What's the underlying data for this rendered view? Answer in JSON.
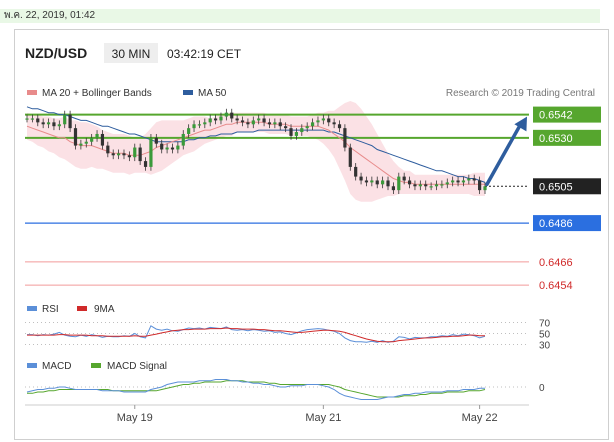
{
  "header": {
    "date": "พ.ค. 22, 2019, 01:42",
    "symbol": "NZD/USD",
    "interval": "30 MIN",
    "time": "03:42:19 CET"
  },
  "colors": {
    "ma20": "#e88b8b",
    "ma50": "#2e5d9e",
    "band_fill": "#f7c8cf",
    "resistance": "#56a62e",
    "support": "#2b6fe0",
    "extra_support": "#f29a9a",
    "current": "#222222",
    "rsi": "#5b8fd8",
    "rsi_ma": "#d02a2a",
    "macd": "#5b8fd8",
    "macd_signal": "#56a62e",
    "arrow": "#2e5d9e"
  },
  "chart_data": {
    "type": "candlestick",
    "title": "NZD/USD",
    "legend": [
      "MA 20 + Bollinger Bands",
      "MA 50"
    ],
    "watermark": "Research © 2019 Trading Central",
    "x_ticks": [
      {
        "label": "May 19",
        "index": 20
      },
      {
        "label": "May 21",
        "index": 55
      },
      {
        "label": "May 22",
        "index": 84
      }
    ],
    "ylim": [
      0.64525,
      0.65485
    ],
    "levels": [
      {
        "value": 0.6542,
        "label": "0.6542",
        "kind": "resistance"
      },
      {
        "value": 0.653,
        "label": "0.6530",
        "kind": "resistance"
      },
      {
        "value": 0.6505,
        "label": "0.6505",
        "kind": "current"
      },
      {
        "value": 0.6486,
        "label": "0.6486",
        "kind": "support"
      },
      {
        "value": 0.6466,
        "label": "0.6466",
        "kind": "extra"
      },
      {
        "value": 0.6454,
        "label": "0.6454",
        "kind": "extra"
      }
    ],
    "close": [
      0.654,
      0.654,
      0.6538,
      0.6537,
      0.6538,
      0.6536,
      0.6537,
      0.6542,
      0.6535,
      0.6526,
      0.6527,
      0.6528,
      0.653,
      0.6532,
      0.6526,
      0.6522,
      0.6521,
      0.6522,
      0.6521,
      0.652,
      0.6525,
      0.6518,
      0.6515,
      0.653,
      0.6527,
      0.6524,
      0.6525,
      0.6524,
      0.6526,
      0.6532,
      0.6535,
      0.6537,
      0.6537,
      0.6538,
      0.654,
      0.6539,
      0.6541,
      0.6543,
      0.654,
      0.6539,
      0.6538,
      0.6537,
      0.6539,
      0.654,
      0.6538,
      0.6537,
      0.6538,
      0.6536,
      0.6535,
      0.6531,
      0.6533,
      0.6535,
      0.6536,
      0.6538,
      0.6539,
      0.654,
      0.6538,
      0.6537,
      0.6535,
      0.6525,
      0.6515,
      0.651,
      0.6508,
      0.6507,
      0.6508,
      0.6506,
      0.6508,
      0.6505,
      0.6503,
      0.651,
      0.6508,
      0.6506,
      0.6505,
      0.6506,
      0.6505,
      0.6505,
      0.6506,
      0.6506,
      0.6507,
      0.6508,
      0.6507,
      0.6508,
      0.6509,
      0.6508,
      0.6503,
      0.6505
    ],
    "ma20": [
      0.6536,
      0.6535,
      0.6534,
      0.6533,
      0.6532,
      0.6531,
      0.653,
      0.653,
      0.6528,
      0.6527,
      0.6526,
      0.6526,
      0.6526,
      0.6525,
      0.6524,
      0.6523,
      0.6522,
      0.6522,
      0.6522,
      0.6521,
      0.6521,
      0.6521,
      0.6522,
      0.6523,
      0.6525,
      0.6526,
      0.6527,
      0.6528,
      0.6529,
      0.653,
      0.6531,
      0.6532,
      0.6533,
      0.6534,
      0.6534,
      0.6535,
      0.6536,
      0.6537,
      0.6537,
      0.6538,
      0.6538,
      0.6538,
      0.6538,
      0.6538,
      0.6538,
      0.6537,
      0.6537,
      0.6537,
      0.6537,
      0.6536,
      0.6536,
      0.6536,
      0.6536,
      0.6536,
      0.6536,
      0.6535,
      0.6534,
      0.6532,
      0.653,
      0.6528,
      0.6525,
      0.6523,
      0.6521,
      0.6519,
      0.6517,
      0.6515,
      0.6513,
      0.6511,
      0.6509,
      0.6508,
      0.6507,
      0.6507,
      0.6506,
      0.6506,
      0.6506,
      0.6506,
      0.6506,
      0.6506,
      0.6506,
      0.6506,
      0.6506,
      0.6506,
      0.6506,
      0.6506,
      0.6506,
      0.6506
    ],
    "ma50": [
      0.6546,
      0.6545,
      0.6545,
      0.6544,
      0.6543,
      0.6543,
      0.6542,
      0.6542,
      0.6541,
      0.654,
      0.6539,
      0.6539,
      0.6538,
      0.6537,
      0.6536,
      0.6536,
      0.6535,
      0.6534,
      0.6533,
      0.6532,
      0.6532,
      0.6531,
      0.653,
      0.6529,
      0.6528,
      0.6528,
      0.6528,
      0.6528,
      0.6528,
      0.6528,
      0.6529,
      0.6529,
      0.653,
      0.653,
      0.6531,
      0.6531,
      0.6532,
      0.6532,
      0.6532,
      0.6533,
      0.6533,
      0.6533,
      0.6533,
      0.6534,
      0.6534,
      0.6534,
      0.6534,
      0.6534,
      0.6534,
      0.6534,
      0.6534,
      0.6534,
      0.6534,
      0.6534,
      0.6534,
      0.6534,
      0.6533,
      0.6533,
      0.6532,
      0.6531,
      0.653,
      0.6529,
      0.6528,
      0.6527,
      0.6526,
      0.6524,
      0.6523,
      0.6522,
      0.6521,
      0.652,
      0.6519,
      0.6518,
      0.6517,
      0.6516,
      0.6515,
      0.6514,
      0.6513,
      0.6513,
      0.6512,
      0.6511,
      0.651,
      0.651,
      0.6509,
      0.6509,
      0.6508,
      0.6507
    ],
    "band": [
      0.0007,
      0.0007,
      0.0008,
      0.0008,
      0.0009,
      0.0009,
      0.001,
      0.0011,
      0.0011,
      0.0012,
      0.0012,
      0.0012,
      0.0011,
      0.0011,
      0.001,
      0.001,
      0.001,
      0.001,
      0.001,
      0.001,
      0.0009,
      0.0009,
      0.001,
      0.0012,
      0.0013,
      0.0013,
      0.0012,
      0.0011,
      0.001,
      0.0009,
      0.0009,
      0.0009,
      0.0008,
      0.0007,
      0.0006,
      0.0006,
      0.0006,
      0.0006,
      0.0006,
      0.0005,
      0.0005,
      0.0005,
      0.0005,
      0.0005,
      0.0005,
      0.0005,
      0.0005,
      0.0005,
      0.0005,
      0.0005,
      0.0005,
      0.0005,
      0.0005,
      0.0006,
      0.0007,
      0.0008,
      0.001,
      0.0012,
      0.0016,
      0.002,
      0.0024,
      0.0025,
      0.0024,
      0.0022,
      0.002,
      0.0017,
      0.0014,
      0.0011,
      0.0009,
      0.0007,
      0.0006,
      0.0006,
      0.0005,
      0.0005,
      0.0005,
      0.0005,
      0.0005,
      0.0005,
      0.0005,
      0.0005,
      0.0005,
      0.0005,
      0.0005,
      0.0006,
      0.0006,
      0.0006
    ],
    "forecast": {
      "from": 0.6505,
      "to": 0.6542
    },
    "rsi": {
      "legend": [
        "RSI",
        "9MA"
      ],
      "levels": [
        70,
        50,
        30
      ],
      "ylim": [
        20,
        80
      ],
      "values": [
        48,
        48,
        46,
        48,
        47,
        49,
        52,
        47,
        45,
        44,
        47,
        45,
        48,
        46,
        43,
        45,
        44,
        44,
        46,
        45,
        50,
        44,
        42,
        64,
        58,
        56,
        58,
        55,
        54,
        57,
        60,
        59,
        60,
        58,
        61,
        60,
        59,
        62,
        57,
        56,
        57,
        55,
        57,
        56,
        54,
        55,
        52,
        53,
        50,
        48,
        51,
        55,
        57,
        58,
        59,
        58,
        56,
        54,
        50,
        42,
        37,
        35,
        35,
        34,
        36,
        34,
        37,
        34,
        36,
        44,
        43,
        40,
        43,
        42,
        42,
        44,
        44,
        46,
        45,
        48,
        46,
        49,
        48,
        46,
        42,
        45
      ],
      "ma": [
        47,
        47,
        47,
        47,
        47,
        47,
        48,
        48,
        47,
        47,
        47,
        47,
        46,
        46,
        46,
        45,
        45,
        45,
        45,
        45,
        46,
        45,
        45,
        47,
        49,
        51,
        53,
        55,
        56,
        57,
        57,
        58,
        58,
        58,
        59,
        59,
        59,
        60,
        59,
        59,
        58,
        58,
        58,
        57,
        57,
        56,
        55,
        55,
        54,
        53,
        52,
        52,
        53,
        54,
        55,
        56,
        56,
        55,
        54,
        52,
        49,
        46,
        43,
        40,
        38,
        36,
        35,
        35,
        35,
        37,
        38,
        39,
        40,
        41,
        42,
        42,
        43,
        44,
        44,
        45,
        45,
        46,
        47,
        47,
        46,
        46
      ]
    },
    "macd": {
      "legend": [
        "MACD",
        "MACD Signal"
      ],
      "zero_label": "0",
      "ylim": [
        -0.0012,
        0.0012
      ],
      "macd": [
        -0.0004,
        -0.0003,
        -0.0002,
        -0.0002,
        -0.0001,
        -0.0001,
        0.0,
        0.0,
        -0.0001,
        -0.0002,
        -0.0002,
        -0.0002,
        -0.0002,
        -0.0002,
        -0.0003,
        -0.0003,
        -0.0003,
        -0.0003,
        -0.0004,
        -0.0004,
        -0.0004,
        -0.0004,
        -0.0004,
        -0.0002,
        -0.0001,
        0.0,
        0.0002,
        0.0003,
        0.0004,
        0.0004,
        0.0004,
        0.0004,
        0.0005,
        0.0005,
        0.0005,
        0.0006,
        0.0006,
        0.0006,
        0.0005,
        0.0005,
        0.0004,
        0.0004,
        0.0003,
        0.0003,
        0.0002,
        0.0002,
        0.0001,
        0.0,
        0.0,
        0.0001,
        0.0001,
        0.0001,
        0.0002,
        0.0002,
        0.0002,
        0.0001,
        0.0,
        -0.0002,
        -0.0005,
        -0.0007,
        -0.0008,
        -0.0009,
        -0.001,
        -0.001,
        -0.001,
        -0.001,
        -0.0009,
        -0.0008,
        -0.0008,
        -0.0007,
        -0.0006,
        -0.0006,
        -0.0005,
        -0.0005,
        -0.0004,
        -0.0004,
        -0.0004,
        -0.0004,
        -0.0003,
        -0.0003,
        -0.0003,
        -0.0002,
        -0.0002,
        -0.0002,
        -0.0001,
        -0.0001
      ],
      "signal": [
        -0.0005,
        -0.0005,
        -0.0004,
        -0.0004,
        -0.0003,
        -0.0003,
        -0.0002,
        -0.0002,
        -0.0002,
        -0.0002,
        -0.0002,
        -0.0002,
        -0.0002,
        -0.0002,
        -0.0002,
        -0.0002,
        -0.0003,
        -0.0003,
        -0.0003,
        -0.0003,
        -0.0003,
        -0.0003,
        -0.0003,
        -0.0003,
        -0.0003,
        -0.0002,
        -0.0001,
        0.0,
        0.0001,
        0.0002,
        0.0002,
        0.0003,
        0.0003,
        0.0004,
        0.0004,
        0.0004,
        0.0004,
        0.0005,
        0.0005,
        0.0005,
        0.0005,
        0.0004,
        0.0004,
        0.0004,
        0.0004,
        0.0003,
        0.0003,
        0.0002,
        0.0002,
        0.0002,
        0.0002,
        0.0002,
        0.0002,
        0.0002,
        0.0002,
        0.0002,
        0.0002,
        0.0001,
        0.0,
        -0.0002,
        -0.0003,
        -0.0004,
        -0.0005,
        -0.0006,
        -0.0007,
        -0.0008,
        -0.0008,
        -0.0008,
        -0.0008,
        -0.0008,
        -0.0007,
        -0.0007,
        -0.0007,
        -0.0006,
        -0.0006,
        -0.0005,
        -0.0005,
        -0.0005,
        -0.0004,
        -0.0004,
        -0.0004,
        -0.0004,
        -0.0003,
        -0.0003,
        -0.0003,
        -0.0002
      ]
    }
  }
}
